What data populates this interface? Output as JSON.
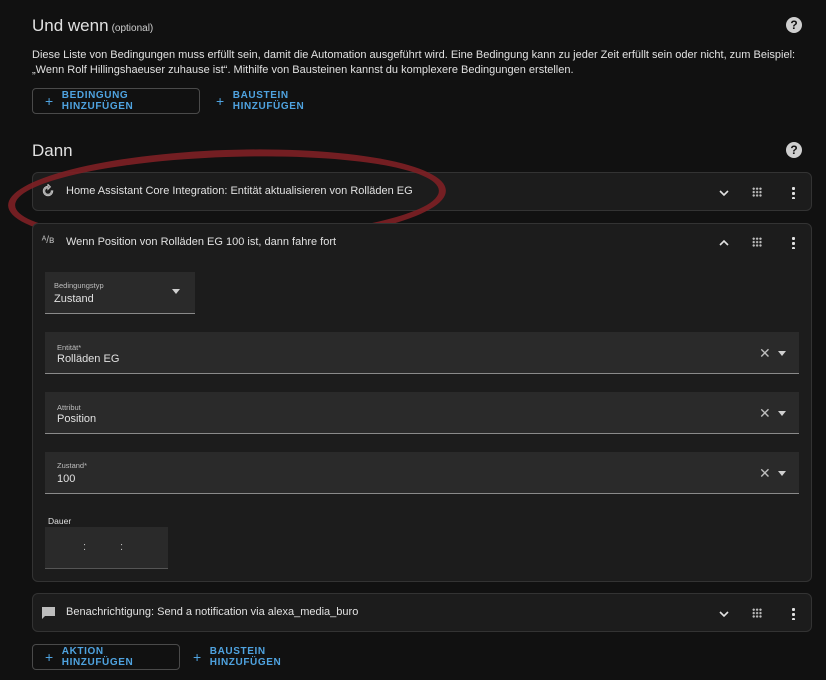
{
  "conditions": {
    "title": "Und wenn",
    "optional": "(optional)",
    "description": "Diese Liste von Bedingungen muss erfüllt sein, damit die Automation ausgeführt wird. Eine Bedingung kann zu jeder Zeit erfüllt sein oder nicht, zum Beispiel: „Wenn Rolf Hillingshaeuser zuhause ist“. Mithilfe von Bausteinen kannst du komplexere Bedingungen erstellen.",
    "add_condition": "BEDINGUNG HINZUFÜGEN",
    "add_block": "BAUSTEIN HINZUFÜGEN"
  },
  "actions": {
    "title": "Dann",
    "items": [
      {
        "icon": "refresh-icon",
        "title": "Home Assistant Core Integration: Entität aktualisieren von Rolläden EG"
      },
      {
        "icon": "ab-icon",
        "title": "Wenn Position von Rolläden EG 100 ist, dann fahre fort"
      },
      {
        "icon": "message-icon",
        "title": "Benachrichtigung: Send a notification via alexa_media_buro"
      }
    ],
    "add_action": "AKTION HINZUFÜGEN",
    "add_block": "BAUSTEIN HINZUFÜGEN"
  },
  "condition_form": {
    "type_label": "Bedingungstyp",
    "type_value": "Zustand",
    "entity_label": "Entität*",
    "entity_value": "Rolläden EG",
    "attribute_label": "Attribut",
    "attribute_value": "Position",
    "state_label": "Zustand*",
    "state_value": "100",
    "duration_label": "Dauer",
    "duration_sep1": ":",
    "duration_sep2": ":"
  },
  "colors": {
    "accent": "#4fa3e0",
    "annotation": "#7c1f24",
    "background": "#111111"
  }
}
